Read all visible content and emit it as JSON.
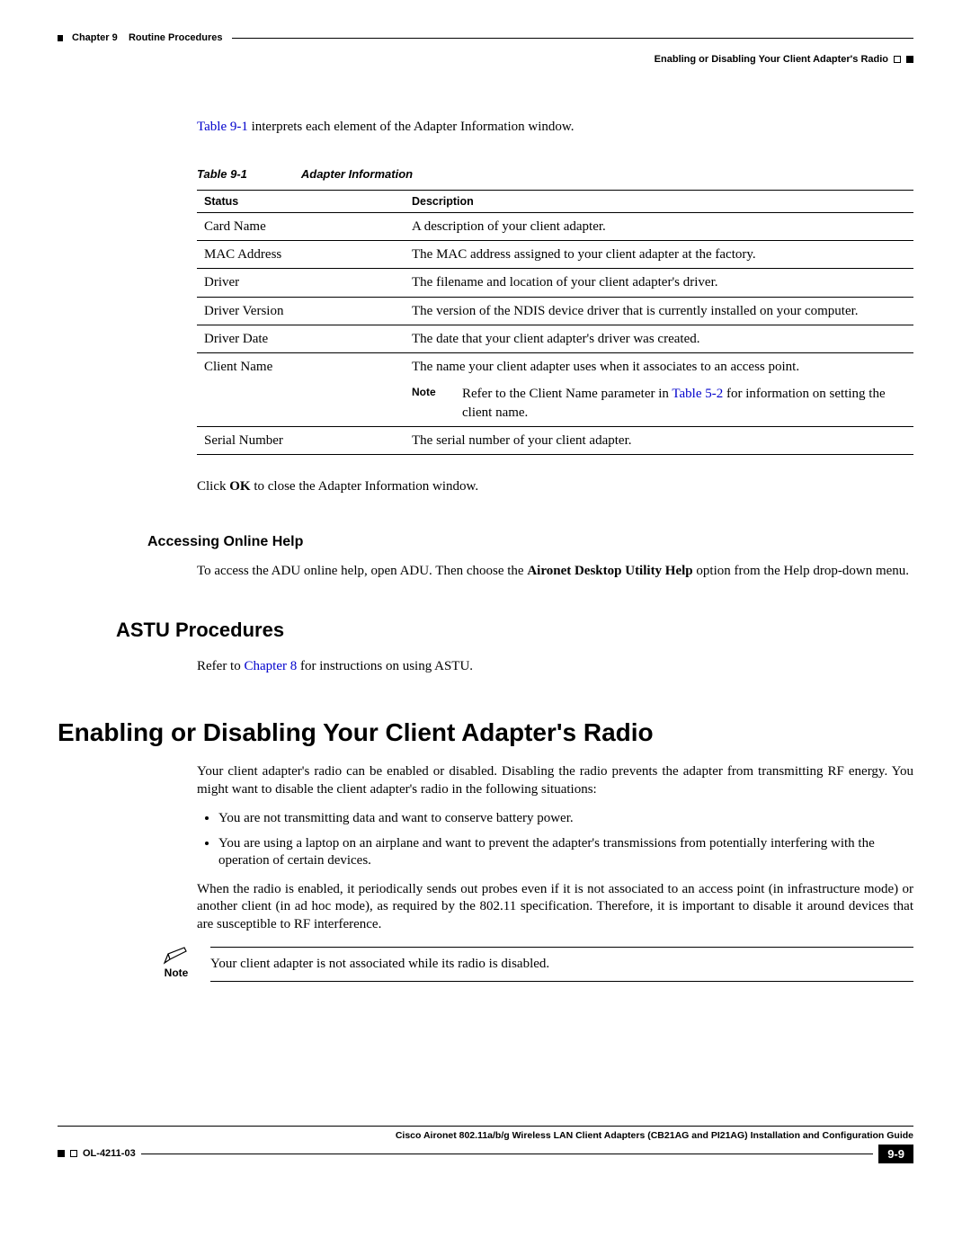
{
  "header": {
    "chapter": "Chapter 9",
    "chapter_title": "Routine Procedures",
    "section_right": "Enabling or Disabling Your Client Adapter's Radio"
  },
  "intro": {
    "table_ref": "Table 9-1",
    "sentence_rest": " interprets each element of the Adapter Information window."
  },
  "table": {
    "caption_label": "Table 9-1",
    "caption_title": "Adapter Information",
    "headers": {
      "status": "Status",
      "description": "Description"
    },
    "rows": [
      {
        "status": "Card Name",
        "description": "A description of your client adapter."
      },
      {
        "status": "MAC Address",
        "description": "The MAC address assigned to your client adapter at the factory."
      },
      {
        "status": "Driver",
        "description": "The filename and location of your client adapter's driver."
      },
      {
        "status": "Driver Version",
        "description": "The version of the NDIS device driver that is currently installed on your computer."
      },
      {
        "status": "Driver Date",
        "description": "The date that your client adapter's driver was created."
      },
      {
        "status": "Client Name",
        "description": "The name your client adapter uses when it associates to an access point.",
        "note_label": "Note",
        "note_pre": "Refer to the Client Name parameter in ",
        "note_link": "Table 5-2",
        "note_post": " for information on setting the client name."
      },
      {
        "status": "Serial Number",
        "description": "The serial number of your client adapter."
      }
    ]
  },
  "close_line": {
    "pre": "Click ",
    "bold": "OK",
    "post": " to close the Adapter Information window."
  },
  "online_help": {
    "heading": "Accessing Online Help",
    "pre": "To access the ADU online help, open ADU. Then choose the ",
    "bold": "Aironet Desktop Utility Help",
    "post": " option from the Help drop-down menu."
  },
  "astu": {
    "heading": "ASTU Procedures",
    "pre": "Refer to ",
    "link": "Chapter 8",
    "post": " for instructions on using ASTU."
  },
  "radio": {
    "heading": "Enabling or Disabling Your Client Adapter's Radio",
    "p1": "Your client adapter's radio can be enabled or disabled. Disabling the radio prevents the adapter from transmitting RF energy. You might want to disable the client adapter's radio in the following situations:",
    "bullets": [
      "You are not transmitting data and want to conserve battery power.",
      "You are using a laptop on an airplane and want to prevent the adapter's transmissions from potentially interfering with the operation of certain devices."
    ],
    "p2": "When the radio is enabled, it periodically sends out probes even if it is not associated to an access point (in infrastructure mode) or another client (in ad hoc mode), as required by the 802.11 specification. Therefore, it is important to disable it around devices that are susceptible to RF interference.",
    "note_label": "Note",
    "note_text": "Your client adapter is not associated while its radio is disabled."
  },
  "footer": {
    "guide_title": "Cisco Aironet 802.11a/b/g Wireless LAN Client Adapters (CB21AG and PI21AG) Installation and Configuration Guide",
    "doc_number": "OL-4211-03",
    "page_number": "9-9"
  }
}
